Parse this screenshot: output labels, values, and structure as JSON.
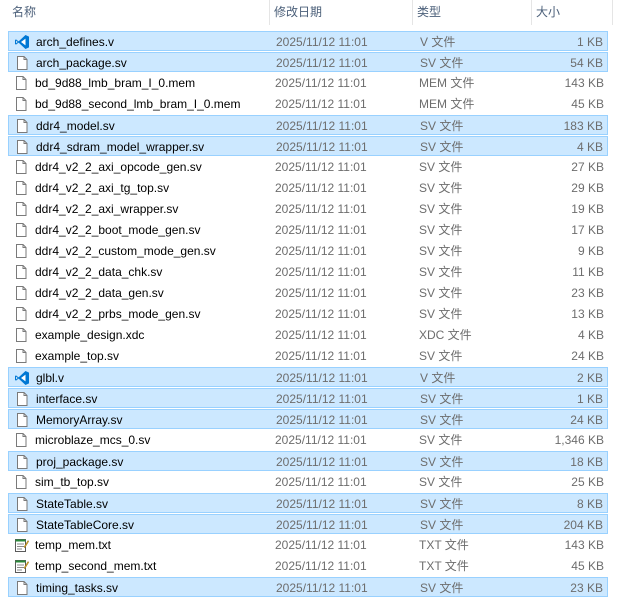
{
  "columns": {
    "name": "名称",
    "date": "修改日期",
    "type": "类型",
    "size": "大小"
  },
  "files": [
    {
      "name": "arch_defines.v",
      "date": "2025/11/12 11:01",
      "type": "V 文件",
      "size": "1 KB",
      "icon": "vscode-icon",
      "selected": true
    },
    {
      "name": "arch_package.sv",
      "date": "2025/11/12 11:01",
      "type": "SV 文件",
      "size": "54 KB",
      "icon": "file-icon",
      "selected": true
    },
    {
      "name": "bd_9d88_lmb_bram_I_0.mem",
      "date": "2025/11/12 11:01",
      "type": "MEM 文件",
      "size": "143 KB",
      "icon": "file-icon",
      "selected": false
    },
    {
      "name": "bd_9d88_second_lmb_bram_I_0.mem",
      "date": "2025/11/12 11:01",
      "type": "MEM 文件",
      "size": "45 KB",
      "icon": "file-icon",
      "selected": false
    },
    {
      "name": "ddr4_model.sv",
      "date": "2025/11/12 11:01",
      "type": "SV 文件",
      "size": "183 KB",
      "icon": "file-icon",
      "selected": true
    },
    {
      "name": "ddr4_sdram_model_wrapper.sv",
      "date": "2025/11/12 11:01",
      "type": "SV 文件",
      "size": "4 KB",
      "icon": "file-icon",
      "selected": true
    },
    {
      "name": "ddr4_v2_2_axi_opcode_gen.sv",
      "date": "2025/11/12 11:01",
      "type": "SV 文件",
      "size": "27 KB",
      "icon": "file-icon",
      "selected": false
    },
    {
      "name": "ddr4_v2_2_axi_tg_top.sv",
      "date": "2025/11/12 11:01",
      "type": "SV 文件",
      "size": "29 KB",
      "icon": "file-icon",
      "selected": false
    },
    {
      "name": "ddr4_v2_2_axi_wrapper.sv",
      "date": "2025/11/12 11:01",
      "type": "SV 文件",
      "size": "19 KB",
      "icon": "file-icon",
      "selected": false
    },
    {
      "name": "ddr4_v2_2_boot_mode_gen.sv",
      "date": "2025/11/12 11:01",
      "type": "SV 文件",
      "size": "17 KB",
      "icon": "file-icon",
      "selected": false
    },
    {
      "name": "ddr4_v2_2_custom_mode_gen.sv",
      "date": "2025/11/12 11:01",
      "type": "SV 文件",
      "size": "9 KB",
      "icon": "file-icon",
      "selected": false
    },
    {
      "name": "ddr4_v2_2_data_chk.sv",
      "date": "2025/11/12 11:01",
      "type": "SV 文件",
      "size": "11 KB",
      "icon": "file-icon",
      "selected": false
    },
    {
      "name": "ddr4_v2_2_data_gen.sv",
      "date": "2025/11/12 11:01",
      "type": "SV 文件",
      "size": "23 KB",
      "icon": "file-icon",
      "selected": false
    },
    {
      "name": "ddr4_v2_2_prbs_mode_gen.sv",
      "date": "2025/11/12 11:01",
      "type": "SV 文件",
      "size": "13 KB",
      "icon": "file-icon",
      "selected": false
    },
    {
      "name": "example_design.xdc",
      "date": "2025/11/12 11:01",
      "type": "XDC 文件",
      "size": "4 KB",
      "icon": "file-icon",
      "selected": false
    },
    {
      "name": "example_top.sv",
      "date": "2025/11/12 11:01",
      "type": "SV 文件",
      "size": "24 KB",
      "icon": "file-icon",
      "selected": false
    },
    {
      "name": "glbl.v",
      "date": "2025/11/12 11:01",
      "type": "V 文件",
      "size": "2 KB",
      "icon": "vscode-icon",
      "selected": true
    },
    {
      "name": "interface.sv",
      "date": "2025/11/12 11:01",
      "type": "SV 文件",
      "size": "1 KB",
      "icon": "file-icon",
      "selected": true
    },
    {
      "name": "MemoryArray.sv",
      "date": "2025/11/12 11:01",
      "type": "SV 文件",
      "size": "24 KB",
      "icon": "file-icon",
      "selected": true
    },
    {
      "name": "microblaze_mcs_0.sv",
      "date": "2025/11/12 11:01",
      "type": "SV 文件",
      "size": "1,346 KB",
      "icon": "file-icon",
      "selected": false
    },
    {
      "name": "proj_package.sv",
      "date": "2025/11/12 11:01",
      "type": "SV 文件",
      "size": "18 KB",
      "icon": "file-icon",
      "selected": true
    },
    {
      "name": "sim_tb_top.sv",
      "date": "2025/11/12 11:01",
      "type": "SV 文件",
      "size": "25 KB",
      "icon": "file-icon",
      "selected": false
    },
    {
      "name": "StateTable.sv",
      "date": "2025/11/12 11:01",
      "type": "SV 文件",
      "size": "8 KB",
      "icon": "file-icon",
      "selected": true
    },
    {
      "name": "StateTableCore.sv",
      "date": "2025/11/12 11:01",
      "type": "SV 文件",
      "size": "204 KB",
      "icon": "file-icon",
      "selected": true
    },
    {
      "name": "temp_mem.txt",
      "date": "2025/11/12 11:01",
      "type": "TXT 文件",
      "size": "143 KB",
      "icon": "notepad-icon",
      "selected": false
    },
    {
      "name": "temp_second_mem.txt",
      "date": "2025/11/12 11:01",
      "type": "TXT 文件",
      "size": "45 KB",
      "icon": "notepad-icon",
      "selected": false
    },
    {
      "name": "timing_tasks.sv",
      "date": "2025/11/12 11:01",
      "type": "SV 文件",
      "size": "23 KB",
      "icon": "file-icon",
      "selected": true
    }
  ],
  "colors": {
    "selection_bg": "#cce8ff",
    "selection_border": "#99d1ff",
    "header_text": "#4c607a",
    "vscode_blue": "#0078d4"
  }
}
